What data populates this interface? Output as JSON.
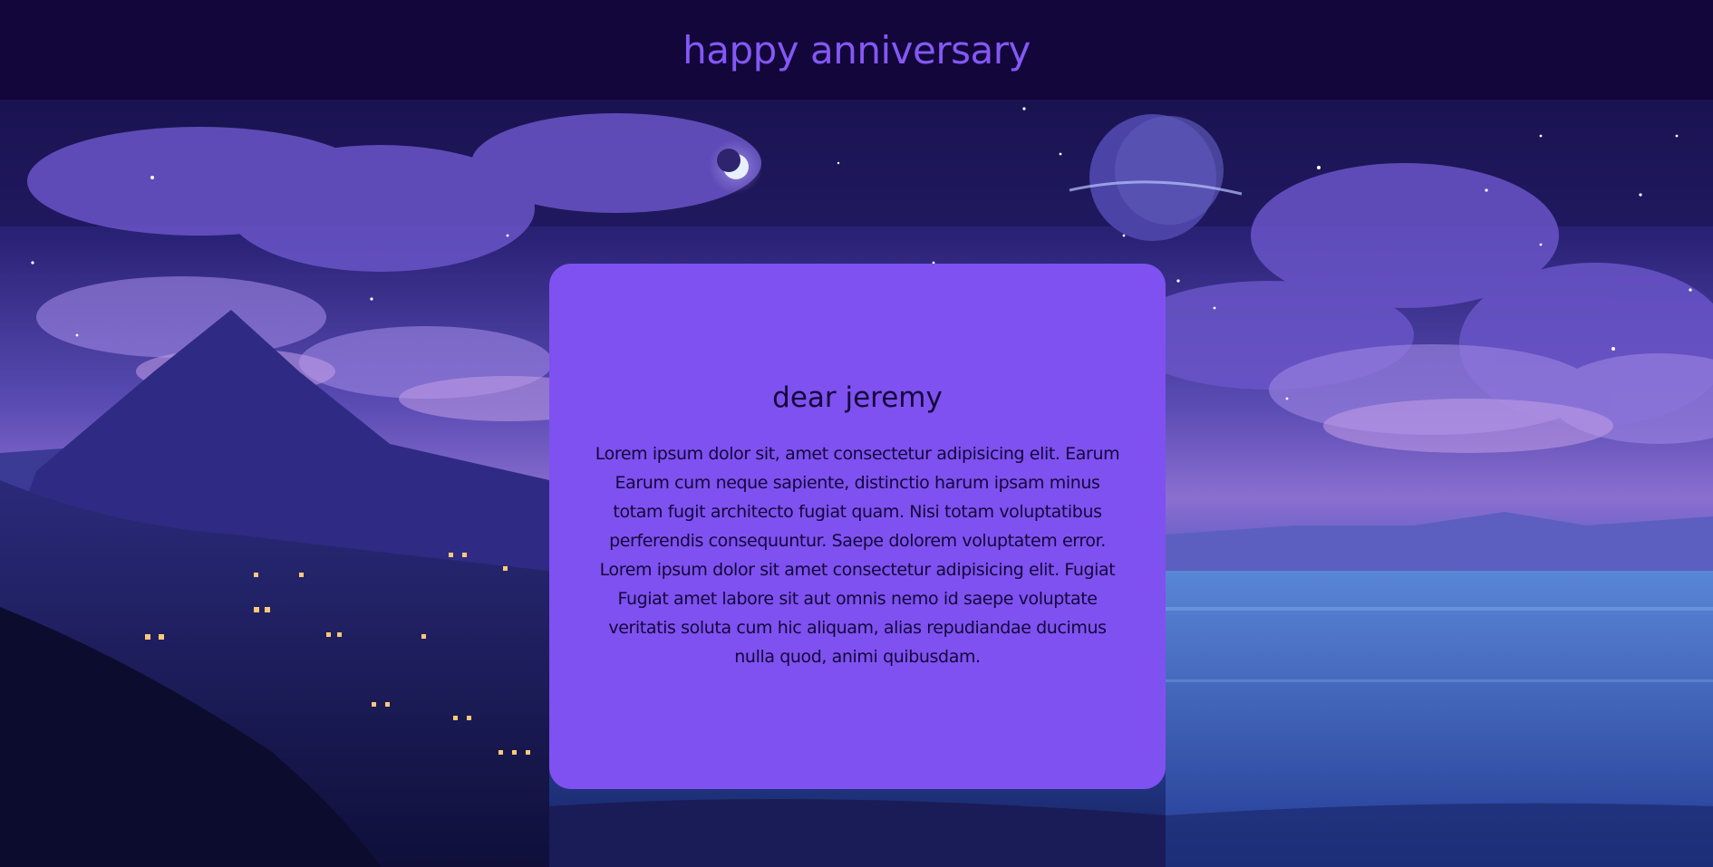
{
  "header": {
    "title": "happy anniversary"
  },
  "background": {
    "scene_description_icon": "night-landscape-illustration"
  },
  "card": {
    "greeting": "dear jeremy",
    "message": "Lorem ipsum dolor sit, amet consectetur adipisicing elit. Earum Earum cum neque sapiente, distinctio harum ipsam minus totam fugit architecto fugiat quam. Nisi totam voluptatibus perferendis consequuntur. Saepe dolorem voluptatem error. Lorem ipsum dolor sit amet consectetur adipisicing elit. Fugiat Fugiat amet labore sit aut omnis nemo id saepe voluptate veritatis soluta cum hic aliquam, alias repudiandae ducimus nulla quod, animi quibusdam."
  },
  "colors": {
    "header_bg": "#12063a",
    "title": "#8458f5",
    "card_bg": "#7f51f0",
    "card_text": "#12063a"
  }
}
